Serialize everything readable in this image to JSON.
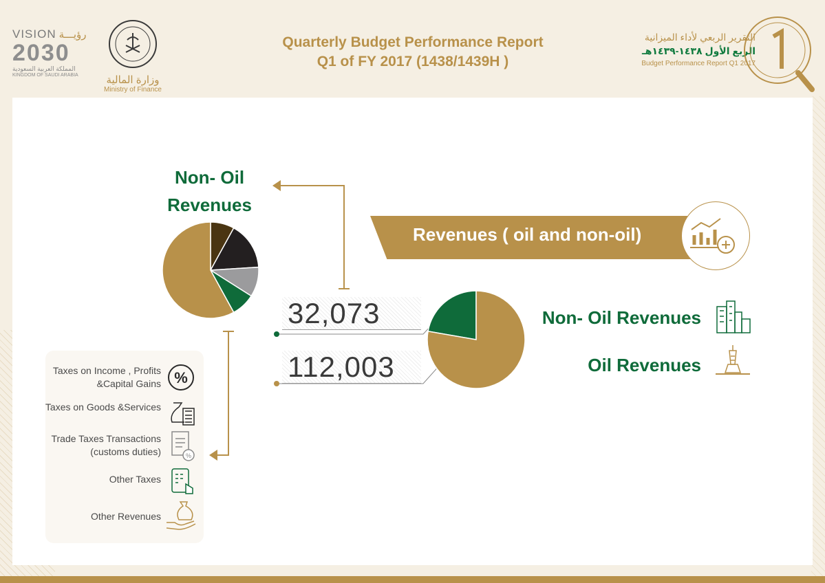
{
  "header": {
    "vision": {
      "line1": "VISION",
      "line1_ar": "رؤيـــة",
      "year": "2030",
      "country_ar": "المملكة العربية السعودية",
      "country_en": "KINGDOM OF SAUDI ARABIA"
    },
    "ministry": {
      "name_ar": "وزارة المالية",
      "name_en": "Ministry of Finance",
      "seal_text": "MINISTRY OF FINANCE"
    },
    "title_line1": "Quarterly Budget Performance Report",
    "title_line2": "Q1 of FY 2017 (1438/1439H )",
    "report_logo": {
      "ar_line1": "التقرير الربعي لأداء الميزانية",
      "ar_line2": "الربع الأول ١٤٣٨-١٤٣٩هـ",
      "en_line": "Budget Performance Report Q1 2017"
    }
  },
  "non_oil_title": "Non- Oil Revenues",
  "banner_text": "Revenues ( oil and non-oil)",
  "values": {
    "non_oil": "32,073",
    "oil": "112,003"
  },
  "legend": {
    "non_oil": "Non- Oil Revenues",
    "oil": "Oil Revenues"
  },
  "tax_categories": [
    {
      "label": "Taxes on Income , Profits &Capital Gains",
      "icon": "percent-icon"
    },
    {
      "label": "Taxes on Goods &Services",
      "icon": "money-bag-calculator-icon"
    },
    {
      "label": "Trade Taxes Transactions (customs duties)",
      "icon": "document-percent-icon"
    },
    {
      "label": "Other Taxes",
      "icon": "tablet-touch-icon"
    },
    {
      "label": "Other Revenues",
      "icon": "hand-money-bag-icon"
    }
  ],
  "colors": {
    "gold": "#b8914a",
    "green": "#0f6b3a",
    "dark": "#231f20",
    "gray": "#9b9b9d",
    "brown": "#4a3512"
  },
  "chart_data": [
    {
      "type": "pie",
      "slices": [
        {
          "label": "Non- Oil Revenues",
          "value": 32073,
          "color": "#0f6b3a"
        },
        {
          "label": "Oil Revenues",
          "value": 112003,
          "color": "#b8914a"
        }
      ]
    },
    {
      "type": "pie",
      "slices": [
        {
          "label": "Taxes on Income , Profits &Capital Gains",
          "value": 8,
          "color": "#4a3512"
        },
        {
          "label": "Taxes on Goods &Services",
          "value": 16,
          "color": "#231f20"
        },
        {
          "label": "Trade Taxes Transactions (customs duties)",
          "value": 10,
          "color": "#9b9b9d"
        },
        {
          "label": "Other Taxes",
          "value": 8,
          "color": "#0f6b3a"
        },
        {
          "label": "Other Revenues",
          "value": 58,
          "color": "#b8914a"
        }
      ]
    }
  ]
}
